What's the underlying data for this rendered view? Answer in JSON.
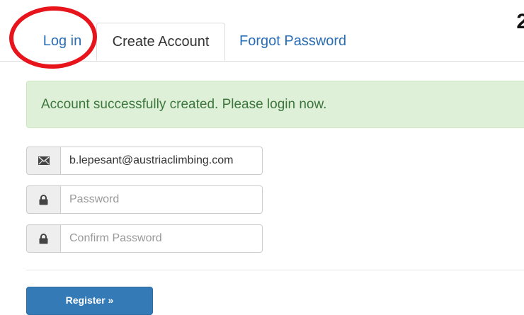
{
  "corner": {
    "text": "2"
  },
  "tabs": [
    {
      "label": "Log in",
      "state": "link"
    },
    {
      "label": "Create Account",
      "state": "active"
    },
    {
      "label": "Forgot Password",
      "state": "link"
    }
  ],
  "alert": {
    "message": "Account successfully created. Please login now."
  },
  "form": {
    "email": {
      "icon": "envelope-icon",
      "value": "b.lepesant@austriaclimbing.com"
    },
    "password": {
      "icon": "lock-icon",
      "placeholder": "Password",
      "value": ""
    },
    "confirm_password": {
      "icon": "lock-icon",
      "placeholder": "Confirm Password",
      "value": ""
    }
  },
  "register_button": {
    "label": "Register »"
  },
  "colors": {
    "link": "#2a6eb5",
    "alert_bg": "#dff0d8",
    "alert_text": "#3c763d",
    "primary": "#337ab7",
    "annotation": "#e8141c"
  }
}
